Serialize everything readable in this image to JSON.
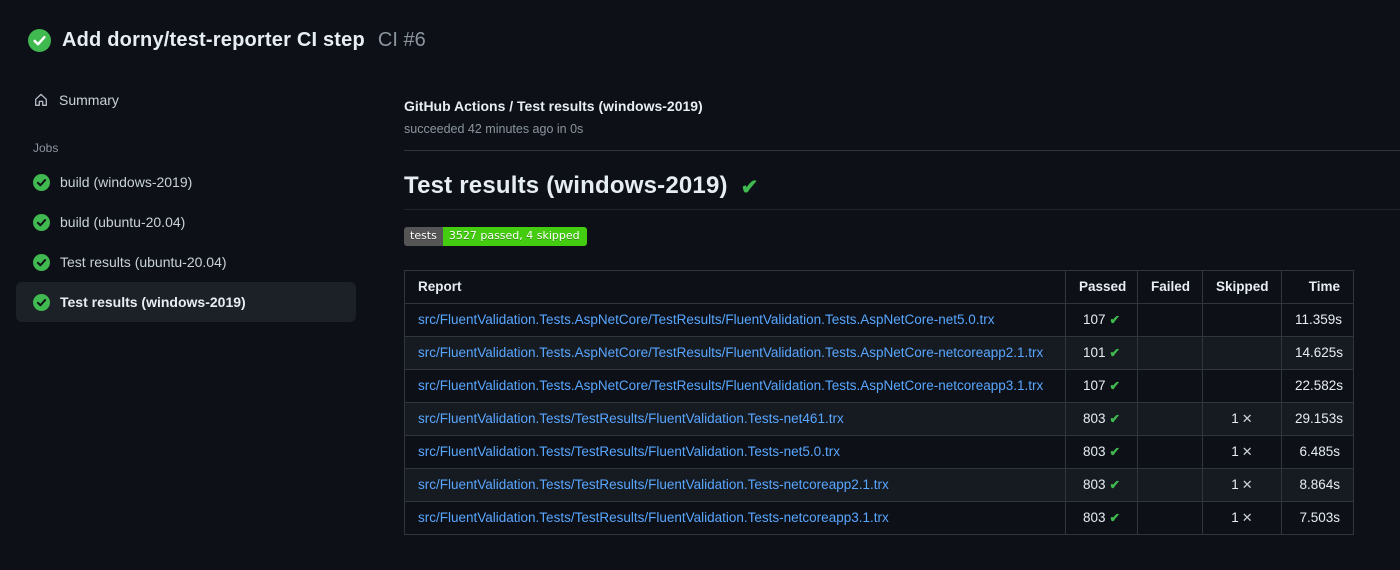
{
  "header": {
    "title": "Add dorny/test-reporter CI step",
    "run_number": "CI #6",
    "status": "success"
  },
  "sidebar": {
    "summary_label": "Summary",
    "jobs_label": "Jobs",
    "jobs": [
      {
        "label": "build (windows-2019)",
        "status": "success",
        "selected": false
      },
      {
        "label": "build (ubuntu-20.04)",
        "status": "success",
        "selected": false
      },
      {
        "label": "Test results (ubuntu-20.04)",
        "status": "success",
        "selected": false
      },
      {
        "label": "Test results (windows-2019)",
        "status": "success",
        "selected": true
      }
    ]
  },
  "main": {
    "workflow_breadcrumb": "GitHub Actions / Test results (windows-2019)",
    "run_meta": "succeeded 42 minutes ago in 0s",
    "section_title": "Test results (windows-2019)",
    "badge": {
      "label": "tests",
      "value": "3527 passed, 4 skipped"
    },
    "table": {
      "columns": [
        "Report",
        "Passed",
        "Failed",
        "Skipped",
        "Time"
      ],
      "rows": [
        {
          "report": "src/FluentValidation.Tests.AspNetCore/TestResults/FluentValidation.Tests.AspNetCore-net5.0.trx",
          "passed": "107",
          "failed": "",
          "skipped": "",
          "time": "11.359s"
        },
        {
          "report": "src/FluentValidation.Tests.AspNetCore/TestResults/FluentValidation.Tests.AspNetCore-netcoreapp2.1.trx",
          "passed": "101",
          "failed": "",
          "skipped": "",
          "time": "14.625s"
        },
        {
          "report": "src/FluentValidation.Tests.AspNetCore/TestResults/FluentValidation.Tests.AspNetCore-netcoreapp3.1.trx",
          "passed": "107",
          "failed": "",
          "skipped": "",
          "time": "22.582s"
        },
        {
          "report": "src/FluentValidation.Tests/TestResults/FluentValidation.Tests-net461.trx",
          "passed": "803",
          "failed": "",
          "skipped": "1",
          "time": "29.153s"
        },
        {
          "report": "src/FluentValidation.Tests/TestResults/FluentValidation.Tests-net5.0.trx",
          "passed": "803",
          "failed": "",
          "skipped": "1",
          "time": "6.485s"
        },
        {
          "report": "src/FluentValidation.Tests/TestResults/FluentValidation.Tests-netcoreapp2.1.trx",
          "passed": "803",
          "failed": "",
          "skipped": "1",
          "time": "8.864s"
        },
        {
          "report": "src/FluentValidation.Tests/TestResults/FluentValidation.Tests-netcoreapp3.1.trx",
          "passed": "803",
          "failed": "",
          "skipped": "1",
          "time": "7.503s"
        }
      ]
    }
  },
  "colors": {
    "background": "#0d1117",
    "success_green": "#3fb950",
    "link_blue": "#58a6ff",
    "muted_text": "#8b949e",
    "border": "#30363d",
    "row_stripe": "#161b22",
    "selected_item_bg": "#1c2128",
    "badge_label_bg": "#555555",
    "badge_value_bg": "#44cc11"
  }
}
